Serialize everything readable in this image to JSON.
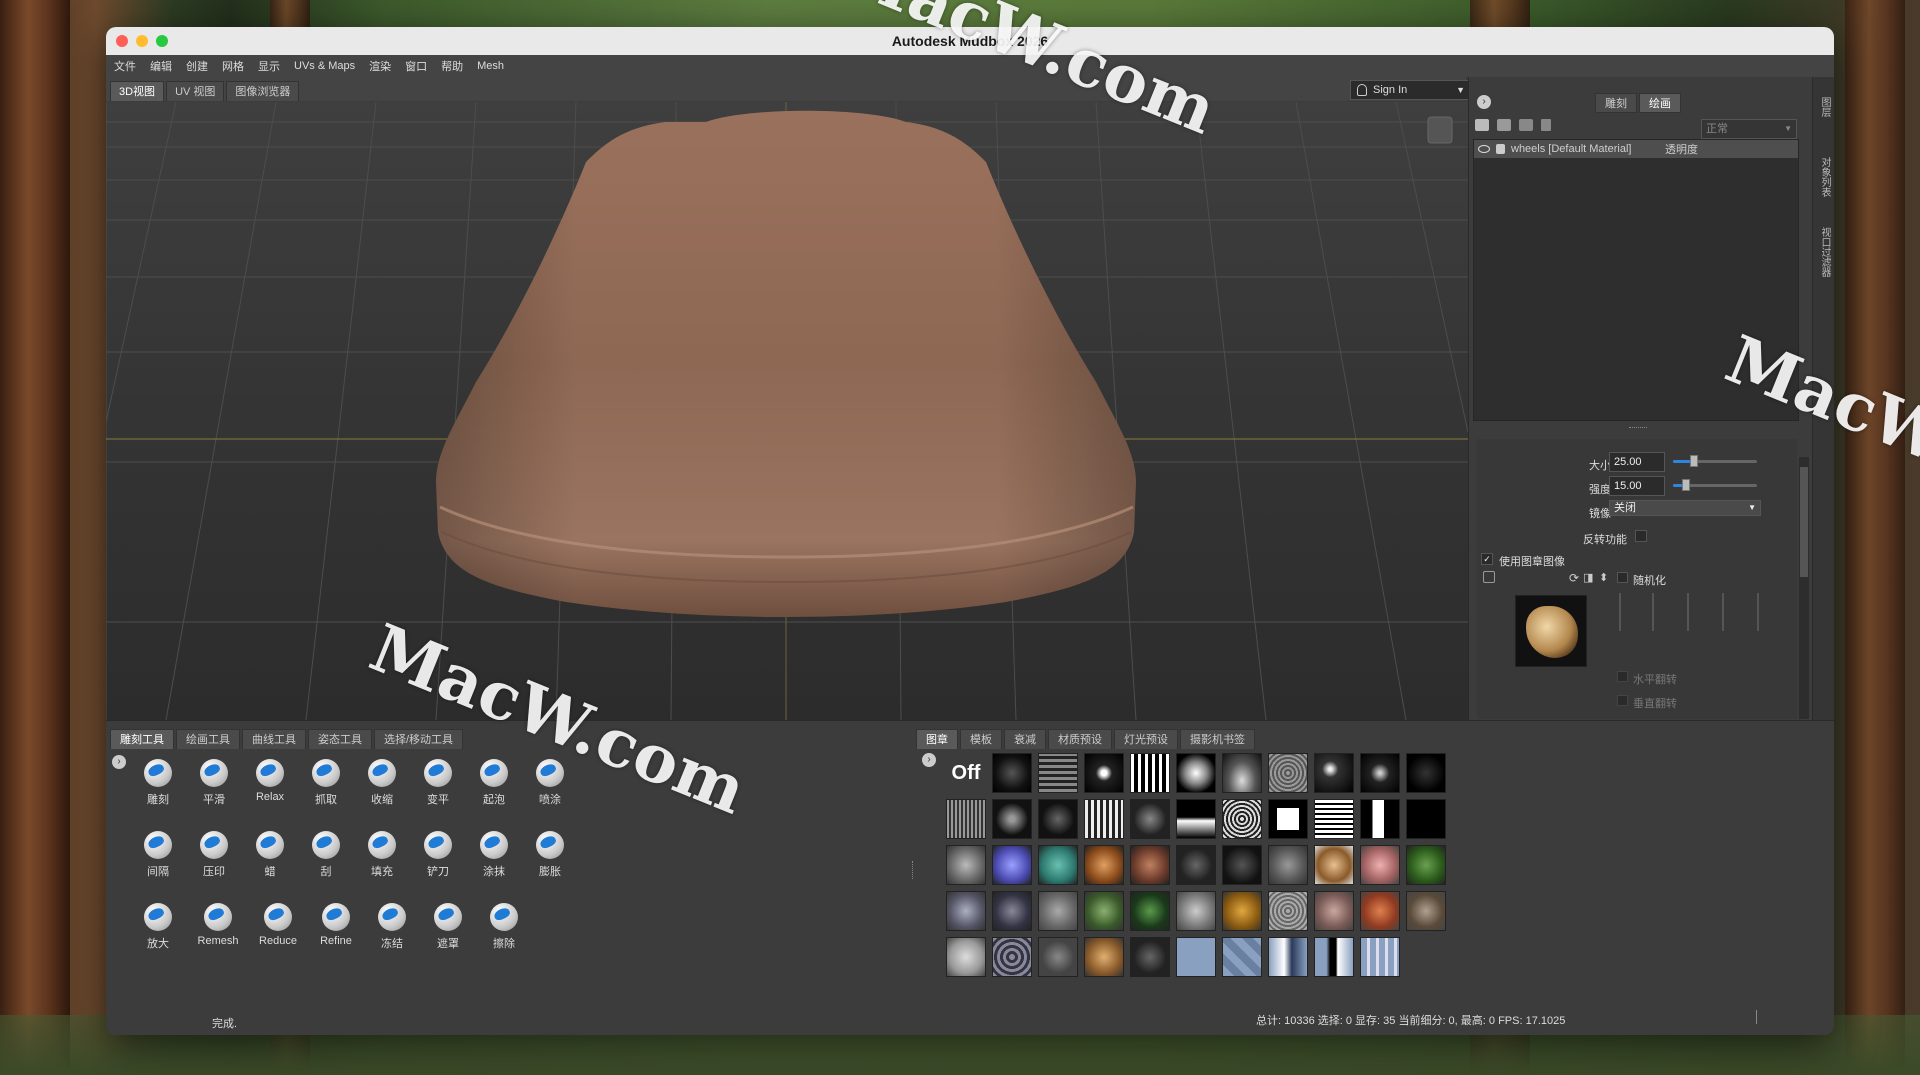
{
  "window": {
    "title": "Autodesk Mudbox 2026"
  },
  "menu": [
    "文件",
    "编辑",
    "创建",
    "网格",
    "显示",
    "UVs & Maps",
    "渲染",
    "窗口",
    "帮助",
    "Mesh"
  ],
  "viewport_tabs": [
    "3D视图",
    "UV 视图",
    "图像浏览器"
  ],
  "signin": {
    "label": "Sign In"
  },
  "right_panel": {
    "tabs": [
      "雕刻",
      "绘画"
    ],
    "blend_mode": "正常",
    "layer": {
      "name": "wheels [Default Material]",
      "opacity_label": "透明度"
    },
    "size": {
      "label": "大小",
      "value": "25.00",
      "fraction": 0.25
    },
    "strength": {
      "label": "强度",
      "value": "15.00",
      "fraction": 0.15
    },
    "mirror": {
      "label": "镜像",
      "value": "关闭"
    },
    "invert": {
      "label": "反转功能"
    },
    "use_stamp": {
      "label": "使用图章图像",
      "checked": true
    },
    "randomize": {
      "label": "随机化"
    },
    "flip_h": {
      "label": "水平翻转"
    },
    "flip_v": {
      "label": "垂直翻转"
    }
  },
  "side_strip": [
    "图层",
    "对象列表",
    "视口过滤器"
  ],
  "bottom_left": {
    "tabs": [
      "雕刻工具",
      "绘画工具",
      "曲线工具",
      "姿态工具",
      "选择/移动工具"
    ],
    "tools": [
      [
        "雕刻",
        "平滑",
        "Relax",
        "抓取",
        "收缩",
        "变平",
        "起泡",
        "喷涂"
      ],
      [
        "间隔",
        "压印",
        "蜡",
        "刮",
        "填充",
        "铲刀",
        "涂抹",
        "膨胀"
      ],
      [
        "放大",
        "Remesh",
        "Reduce",
        "Refine",
        "冻结",
        "遮罩",
        "擦除"
      ]
    ]
  },
  "bottom_right": {
    "tabs": [
      "图章",
      "模板",
      "衰减",
      "材质预设",
      "灯光预设",
      "摄影机书签"
    ],
    "off_label": "Off"
  },
  "status": {
    "left": "完成.",
    "right": "总计: 10336  选择: 0 显存: 35  当前细分: 0, 最高: 0  FPS: 17.1025"
  },
  "watermarks": [
    "MacW.com",
    "MacW.com",
    "MacW.c"
  ]
}
